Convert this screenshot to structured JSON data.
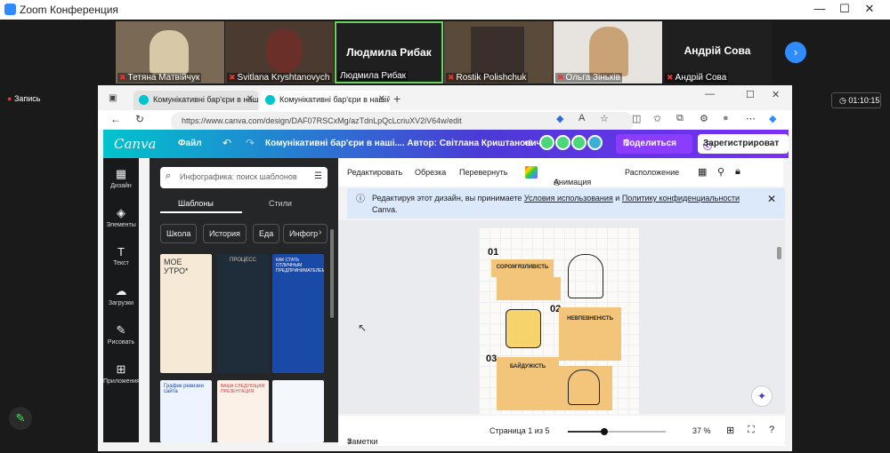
{
  "zoom": {
    "title": "Zoom Конференция",
    "record_label": "Запись",
    "timer": "01:10:15",
    "participants": [
      {
        "name": "Тетяна Матвійчук",
        "muted": true,
        "video": true
      },
      {
        "name": "Svitlana Kryshtanovych",
        "muted": true,
        "video": true
      },
      {
        "name": "Людмила Рибак",
        "big_name": "Людмила Рибак",
        "muted": false,
        "video": false
      },
      {
        "name": "Rostik Polishchuk",
        "muted": true,
        "video": true
      },
      {
        "name": "Ольга Зіньків",
        "muted": true,
        "video": true
      },
      {
        "name": "Андрій Сова",
        "big_name": "Андрій Сова",
        "muted": true,
        "video": false
      }
    ]
  },
  "browser": {
    "tabs": [
      {
        "label": "Комунікативні бар'єри в нашій..."
      },
      {
        "label": "Комунікативні бар'єри в нашій..."
      }
    ],
    "url": "https://www.canva.com/design/DAF07RSCxMg/azTdnLpQcLcriuXV2iV64w/edit"
  },
  "canva": {
    "logo": "Canva",
    "file_menu": "Файл",
    "doc_title": "Комунікативні бар'єри в наші.... Автор: Світлана Криштанович",
    "collab_count": "+3",
    "share_button": "Поделиться",
    "register_button": "Зарегистрироват",
    "rail": [
      {
        "icon": "▦",
        "label": "Дизайн"
      },
      {
        "icon": "◈",
        "label": "Элементы"
      },
      {
        "icon": "T",
        "label": "Текст"
      },
      {
        "icon": "☁",
        "label": "Загрузки"
      },
      {
        "icon": "✎",
        "label": "Рисовать"
      },
      {
        "icon": "⊞",
        "label": "Приложения"
      }
    ],
    "search_placeholder": "Инфографика: поиск шаблонов",
    "panel_tabs": [
      "Шаблоны",
      "Стили"
    ],
    "chips": [
      "Школа",
      "История",
      "Еда",
      "Инфогр"
    ],
    "toolbar": [
      "Редактировать",
      "Обрезка",
      "Перевернуть",
      "Анимация",
      "Расположение"
    ],
    "notice": {
      "text_before": "Редактируя этот дизайн, вы принимаете ",
      "terms": "Условия использования",
      "and": " и ",
      "privacy": "Политику конфиденциальности",
      "text_after": "Canva."
    },
    "design_items": [
      {
        "num": "01",
        "label": "СОРОМ'ЯЗЛИВІСТЬ"
      },
      {
        "num": "02",
        "label": "НЕВПЕВНЕНІСТЬ"
      },
      {
        "num": "03",
        "label": "БАЙДУЖІСТЬ"
      }
    ],
    "bottom": {
      "notes": "Заметки",
      "page": "Страница 1 из 5",
      "zoom": "37 %",
      "zoom_level_fraction": 0.37
    },
    "thumb_text": {
      "t1": "МОЕ УТРО*",
      "t2": "ПРОЦЕСС",
      "t3": "КАК СТАТЬ ОТЛИЧНЫМ ПРЕДПРИНИМАТЕЛЕМ",
      "t4": "График ревизии сайта",
      "t5": "ВАША СЛЕДУЮЩАЯ ПРЕЗЕНТАЦИЯ"
    },
    "colors": {
      "canva_teal": "#00c4cc",
      "canva_purple": "#7b2ff7",
      "share_bg": "#8b3dff",
      "note_orange": "#f3c57b"
    }
  }
}
